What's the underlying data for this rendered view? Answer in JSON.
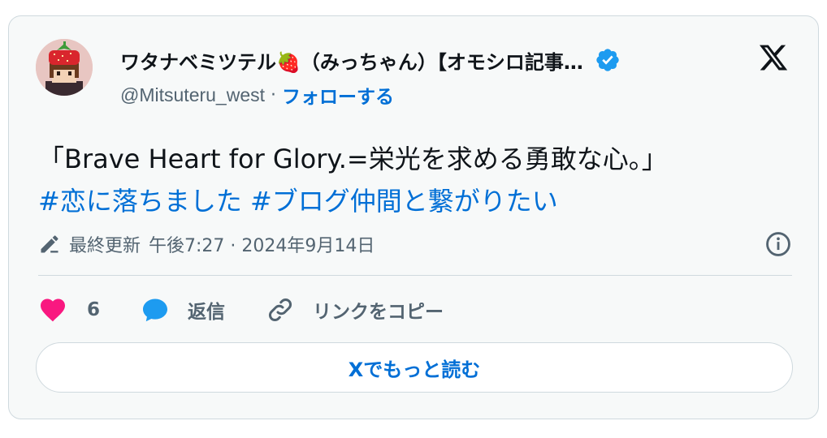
{
  "author": {
    "display_name": "ワタナベミツテル🍓（みっちゃん）【オモシロ記事…",
    "handle": "@Mitsuteru_west",
    "separator": "·",
    "follow_label": "フォローする",
    "verified": true
  },
  "tweet": {
    "text_line": "「Brave Heart for Glory.=栄光を求める勇敢な心。」",
    "hashtags": "#恋に落ちました #ブログ仲間と繋がりたい"
  },
  "meta": {
    "edited_label": "最終更新",
    "timestamp": "午後7:27 · 2024年9月14日"
  },
  "actions": {
    "like_count": "6",
    "reply_label": "返信",
    "copy_link_label": "リンクをコピー"
  },
  "read_more_label": "Xでもっと読む",
  "colors": {
    "link_blue": "#006fd6",
    "like_pink": "#f91880",
    "reply_blue": "#1d9bf0",
    "muted": "#536471",
    "border": "#cfd9de"
  }
}
